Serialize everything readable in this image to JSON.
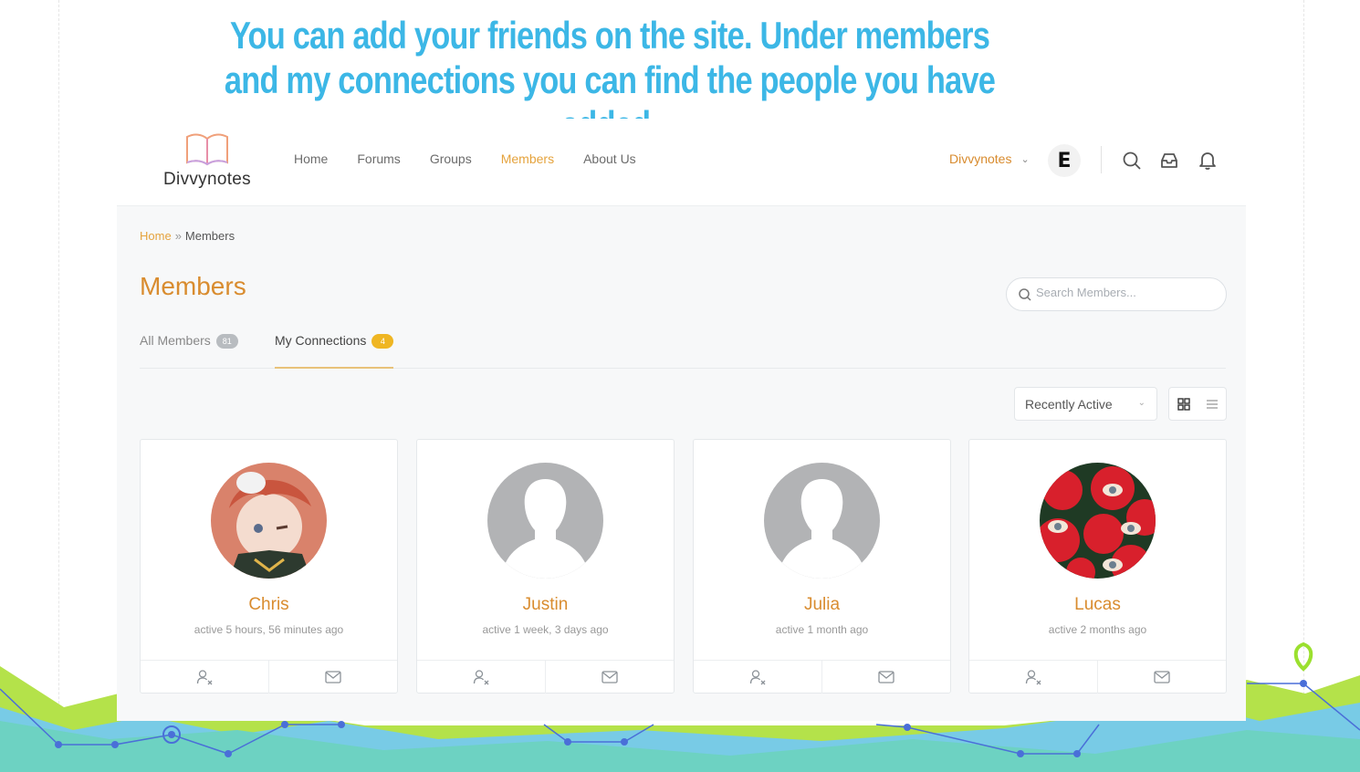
{
  "caption": "You can add your friends on the site. Under members and my connections you can find the people you have added.",
  "colors": {
    "accent": "#e5a33d",
    "caption": "#3cb7e6",
    "badge_gold": "#efb623"
  },
  "logo": {
    "text": "Divvynotes",
    "icon": "open-book-icon"
  },
  "nav": {
    "items": [
      "Home",
      "Forums",
      "Groups",
      "Members",
      "About Us"
    ],
    "active": "Members"
  },
  "user_menu": {
    "name": "Divvynotes",
    "avatar_text": "E",
    "icons": [
      "search-icon",
      "inbox-icon",
      "bell-icon"
    ]
  },
  "breadcrumb": {
    "home": "Home",
    "separator": "»",
    "current": "Members"
  },
  "page": {
    "title": "Members"
  },
  "search": {
    "placeholder": "Search Members..."
  },
  "tabs": [
    {
      "label": "All Members",
      "count": "81",
      "active": false
    },
    {
      "label": "My Connections",
      "count": "4",
      "active": true
    }
  ],
  "sort": {
    "selected": "Recently Active"
  },
  "view_toggle": {
    "selected": "grid"
  },
  "members": [
    {
      "name": "Chris",
      "status": "active 5 hours, 56 minutes ago",
      "avatar": "anime-character"
    },
    {
      "name": "Justin",
      "status": "active 1 week, 3 days ago",
      "avatar": "default"
    },
    {
      "name": "Julia",
      "status": "active 1 month ago",
      "avatar": "default"
    },
    {
      "name": "Lucas",
      "status": "active 2 months ago",
      "avatar": "red-flowers-eyes"
    }
  ]
}
